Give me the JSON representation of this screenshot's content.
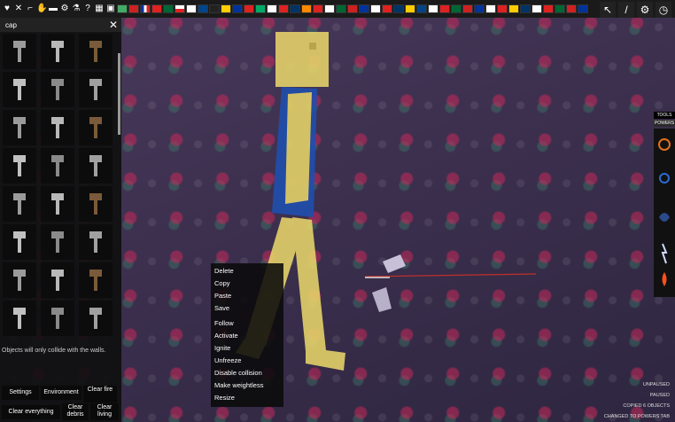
{
  "search": {
    "query": "cap",
    "close_label": "✕"
  },
  "top_right": {
    "cursor_label": "↖",
    "sword_label": "/",
    "settings_label": "⚙",
    "clock_label": "◷"
  },
  "hint": "Objects will only collide with the walls.",
  "bottom_buttons": {
    "settings": "Settings",
    "environment": "Environment",
    "clear_fire": "Clear fire",
    "clear_everything": "Clear everything",
    "clear_debris": "Clear debris",
    "clear_living": "Clear living"
  },
  "context_menu": {
    "delete": "Delete",
    "copy": "Copy",
    "paste": "Paste",
    "save": "Save",
    "follow": "Follow",
    "activate": "Activate",
    "ignite": "Ignite",
    "unfreeze": "Unfreeze",
    "disable_collision": "Disable collision",
    "make_weightless": "Make weightless",
    "resize": "Resize"
  },
  "tools_panel": {
    "tools_tab": "TOOLS",
    "powers_tab": "POWERS"
  },
  "status_log": [
    "UNPAUSED",
    "PAUSED",
    "COPIED 6 OBJECTS",
    "CHANGED TO POWERS TAB"
  ],
  "items": [
    "hammer-item",
    "axe-item",
    "cleaver-item",
    "mallet-item",
    "blade-item",
    "spear-item",
    "mace-item",
    "hammer-item",
    "sword-item",
    "knife-item",
    "halberd-item",
    "dark-item",
    "stick-item",
    "rifle-item",
    "club-item",
    "rod-item",
    "flail-item",
    "bat-item",
    "shuriken-item",
    "canister-item",
    "shovel-item",
    "axe-item",
    "dagger-item",
    "machete-item"
  ],
  "colors": {
    "person_skin": "#e8d56a",
    "shirt": "#1f4fb0",
    "panel_bg": "#0f0f0f",
    "menu_bg": "#0a0a0a"
  }
}
